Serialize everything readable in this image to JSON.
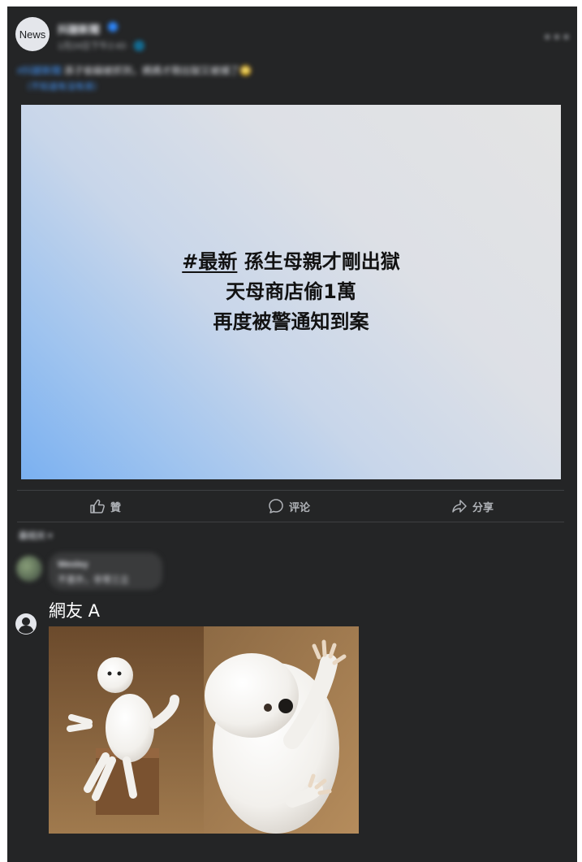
{
  "header": {
    "avatar_label": "News",
    "page_name": "抖腿新聞",
    "post_meta": "1月24日下午2:43 · 🌐",
    "more_icon": "more-horizontal-icon"
  },
  "caption": {
    "hashtag": "#抖腿新聞",
    "text": "孫子偷竊被抓到，媽媽才剛出獄又被捕了🙄",
    "link": "（不知道有沒有孫）"
  },
  "card": {
    "line1_tag": "#最新",
    "line1_rest": " 孫生母親才剛出獄",
    "line2": "天母商店偷1萬",
    "line3": "再度被警通知到案",
    "gradient_colors": [
      "#e4e4e4",
      "#dde0e6",
      "#c8d6ea",
      "#9ec3ef",
      "#7ab0f0"
    ]
  },
  "actions": {
    "like_label": "贊",
    "comment_label": "评论",
    "share_label": "分享"
  },
  "comments": {
    "sort_label": "最相关 ▾",
    "first": {
      "name": "Wesley",
      "text": "不意外，非常三立"
    },
    "second": {
      "name": "網友 A",
      "image": "persian-cat-room-guardian-meme"
    }
  },
  "colors": {
    "background": "#242526",
    "text_primary": "#e4e6eb",
    "text_secondary": "#b0b3b8",
    "link": "#4599ff",
    "divider": "#3e4042"
  }
}
